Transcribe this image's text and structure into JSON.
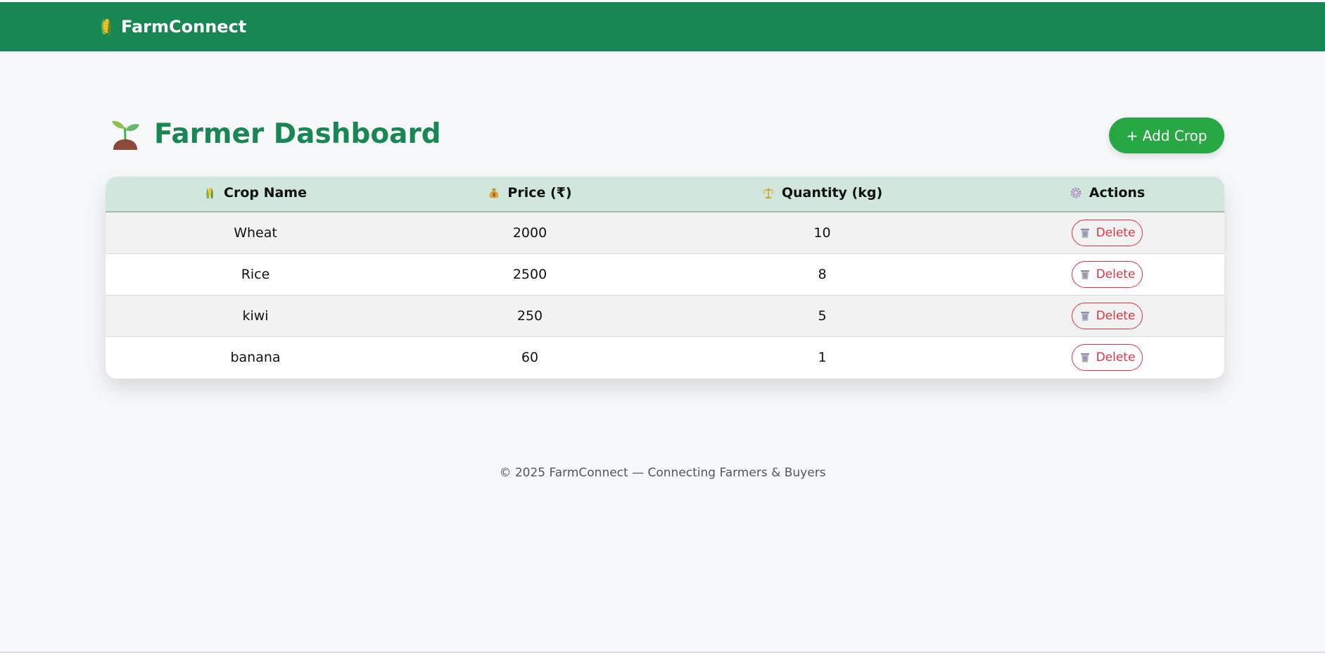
{
  "navbar": {
    "brand": "FarmConnect",
    "brand_icon": "corn-icon",
    "color": "#198754"
  },
  "header": {
    "title": "Farmer Dashboard",
    "title_icon": "seedling-icon",
    "add_button": "+ Add Crop"
  },
  "table": {
    "columns": [
      {
        "label": "Crop Name",
        "icon": "corn-icon"
      },
      {
        "label": "Price (₹)",
        "icon": "money-bag-icon"
      },
      {
        "label": "Quantity (kg)",
        "icon": "scale-icon"
      },
      {
        "label": "Actions",
        "icon": "gear-icon"
      }
    ],
    "rows": [
      {
        "name": "Wheat",
        "price": "2000",
        "quantity": "10",
        "action": "Delete"
      },
      {
        "name": "Rice",
        "price": "2500",
        "quantity": "8",
        "action": "Delete"
      },
      {
        "name": "kiwi",
        "price": "250",
        "quantity": "5",
        "action": "Delete"
      },
      {
        "name": "banana",
        "price": "60",
        "quantity": "1",
        "action": "Delete"
      }
    ]
  },
  "footer": {
    "text": "© 2025 FarmConnect — Connecting Farmers & Buyers"
  },
  "colors": {
    "primary": "#198754",
    "add_button": "#28a745",
    "table_header": "#d1e7dd",
    "danger": "#dc3545"
  }
}
